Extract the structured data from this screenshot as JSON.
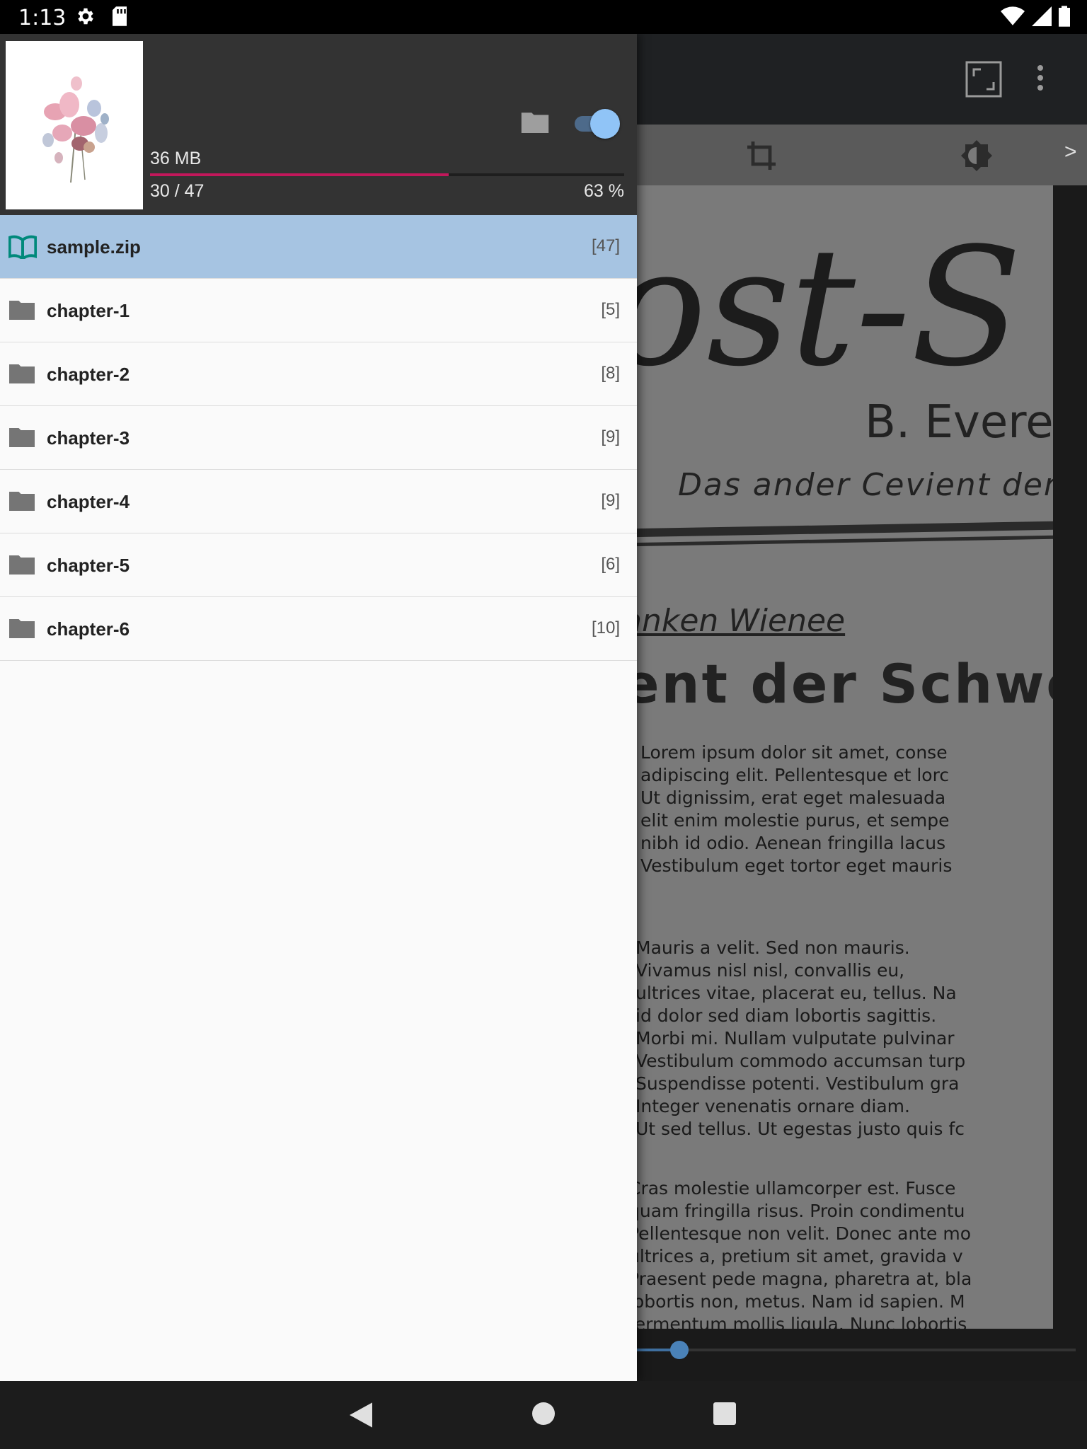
{
  "status_bar": {
    "time": "1:13",
    "icons": [
      "gear-icon",
      "sd-card-icon",
      "wifi-icon",
      "signal-icon",
      "battery-icon"
    ]
  },
  "reader": {
    "toolbar_icons": [
      "fullscreen-icon",
      "more-vert-icon"
    ],
    "subbar_icons": [
      "crop-icon",
      "brightness-icon"
    ],
    "next_label": ">",
    "page": {
      "title_fragment": "ost-S",
      "author_fragment": "B. Everet",
      "subtitle_fragment": "Das ander Cevient der",
      "headline_fragment": "anken Wienee",
      "headline2_fragment": "ent der Schweiz",
      "para1": "Lorem ipsum dolor sit amet, conse\nadipiscing elit. Pellentesque et lorc\nUt dignissim, erat eget malesuada\nelit enim molestie purus, et sempe\nnibh id odio. Aenean fringilla lacus\nVestibulum eget tortor eget mauris",
      "para2": "Mauris a velit. Sed non mauris.\nVivamus nisl nisl, convallis eu,\nultrices vitae, placerat eu, tellus. Na\nid dolor sed diam lobortis sagittis.\nMorbi mi. Nullam vulputate pulvinar\nVestibulum commodo accumsan turp\nSuspendisse potenti. Vestibulum gra\nInteger venenatis ornare diam.\nUt sed tellus. Ut egestas justo quis fc",
      "para3": "Cras molestie ullamcorper est. Fusce\nquam fringilla risus. Proin condimentu\nPellentesque non velit. Donec ante mo\nultrices a, pretium sit amet, gravida v\nPraesent pede magna, pharetra at, bla\nlobortis non, metus. Nam id sapien. M\nfermentum mollis ligula. Nunc lobortis\ncursus faucibus, ligula mauris accums.\nget tincidunt pede massa eget nisl. E"
    }
  },
  "drawer": {
    "header": {
      "size": "36 MB",
      "progress_label": "30 / 47",
      "percent_label": "63 %",
      "progress_fraction": 0.63,
      "toggle_on": true,
      "accent_color": "#c2185b"
    },
    "items": [
      {
        "name": "sample.zip",
        "count": "[47]",
        "icon": "book-open-icon",
        "selected": true
      },
      {
        "name": "chapter-1",
        "count": "[5]",
        "icon": "folder-icon",
        "selected": false
      },
      {
        "name": "chapter-2",
        "count": "[8]",
        "icon": "folder-icon",
        "selected": false
      },
      {
        "name": "chapter-3",
        "count": "[9]",
        "icon": "folder-icon",
        "selected": false
      },
      {
        "name": "chapter-4",
        "count": "[9]",
        "icon": "folder-icon",
        "selected": false
      },
      {
        "name": "chapter-5",
        "count": "[6]",
        "icon": "folder-icon",
        "selected": false
      },
      {
        "name": "chapter-6",
        "count": "[10]",
        "icon": "folder-icon",
        "selected": false
      }
    ]
  },
  "nav_bar": {
    "icons": [
      "back-icon",
      "home-icon",
      "recents-icon"
    ]
  }
}
